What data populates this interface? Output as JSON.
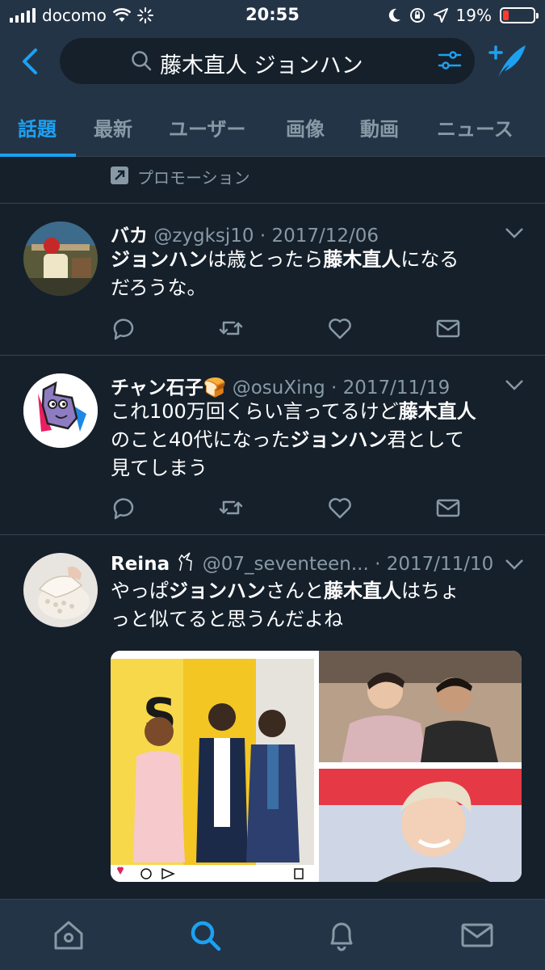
{
  "status_bar": {
    "carrier": "docomo",
    "time": "20:55",
    "battery": "19%"
  },
  "search": {
    "query": "藤木直人 ジョンハン"
  },
  "tabs": [
    {
      "label": "話題",
      "active": true
    },
    {
      "label": "最新"
    },
    {
      "label": "ユーザー"
    },
    {
      "label": "画像"
    },
    {
      "label": "動画"
    },
    {
      "label": "ニュース"
    }
  ],
  "promotion": {
    "label": "プロモーション"
  },
  "tweets": [
    {
      "name": "バカ",
      "handle": "@zygksj10",
      "date": "· 2017/12/06",
      "text_parts": [
        {
          "t": "ジョンハン",
          "b": true
        },
        {
          "t": "は歳とったら"
        },
        {
          "t": "藤木直人",
          "b": true
        },
        {
          "t": "になる"
        },
        {
          "t": "だろうな。"
        }
      ]
    },
    {
      "name": "チャン石子🍞",
      "handle": "@osuXing",
      "date": "· 2017/11/19",
      "text_parts": [
        {
          "t": "これ100万回くらい言ってるけど"
        },
        {
          "t": "藤木直人",
          "b": true
        },
        {
          "t": "のこと40代になった"
        },
        {
          "t": "ジョンハン",
          "b": true
        },
        {
          "t": "君として"
        },
        {
          "t": "見てしまう"
        }
      ]
    },
    {
      "name": "Reina",
      "handle": "@07_seventeen...",
      "date": "· 2017/11/10",
      "text_parts": [
        {
          "t": "やっぱ"
        },
        {
          "t": "ジョンハン",
          "b": true
        },
        {
          "t": "さんと"
        },
        {
          "t": "藤木直人",
          "b": true
        },
        {
          "t": "はちょ"
        },
        {
          "t": "っと似てると思うんだよね"
        }
      ]
    }
  ],
  "colors": {
    "accent": "#1da1f2",
    "background": "#15202b",
    "header": "#243447",
    "muted": "#8899a6"
  }
}
